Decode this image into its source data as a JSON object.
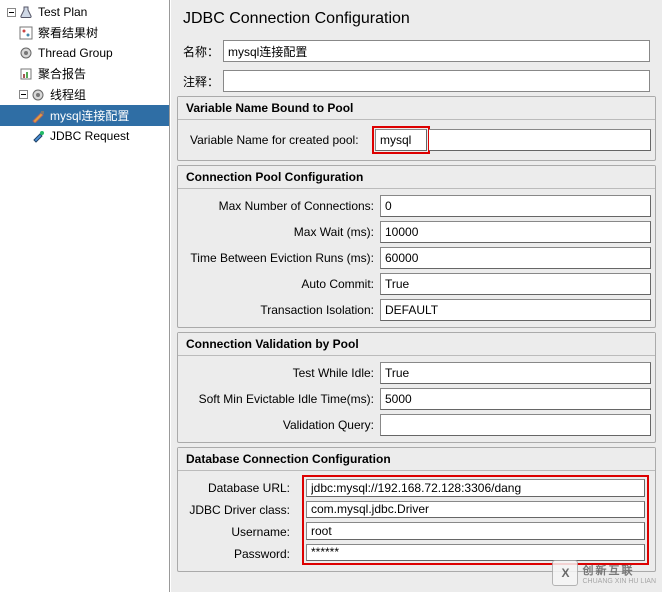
{
  "tree": {
    "root": "Test Plan",
    "items": [
      {
        "label": "察看结果树"
      },
      {
        "label": "Thread Group"
      },
      {
        "label": "聚合报告"
      },
      {
        "label": "线程组"
      },
      {
        "label": "mysql连接配置"
      },
      {
        "label": "JDBC Request"
      }
    ]
  },
  "panel": {
    "title": "JDBC Connection Configuration",
    "name_label": "名称：",
    "name_value": "mysql连接配置",
    "comment_label": "注释：",
    "comment_value": ""
  },
  "var_pool": {
    "section": "Variable Name Bound to Pool",
    "label": "Variable Name for created pool:",
    "value": "mysql"
  },
  "pool_cfg": {
    "section": "Connection Pool Configuration",
    "max_conn_label": "Max Number of Connections:",
    "max_conn_value": "0",
    "max_wait_label": "Max Wait (ms):",
    "max_wait_value": "10000",
    "evict_label": "Time Between Eviction Runs (ms):",
    "evict_value": "60000",
    "auto_commit_label": "Auto Commit:",
    "auto_commit_value": "True",
    "txn_iso_label": "Transaction Isolation:",
    "txn_iso_value": "DEFAULT"
  },
  "valid_cfg": {
    "section": "Connection Validation by Pool",
    "test_idle_label": "Test While Idle:",
    "test_idle_value": "True",
    "soft_min_label": "Soft Min Evictable Idle Time(ms):",
    "soft_min_value": "5000",
    "valid_query_label": "Validation Query:",
    "valid_query_value": ""
  },
  "db_cfg": {
    "section": "Database Connection Configuration",
    "url_label": "Database URL:",
    "url_value": "jdbc:mysql://192.168.72.128:3306/dang",
    "driver_label": "JDBC Driver class:",
    "driver_value": "com.mysql.jdbc.Driver",
    "user_label": "Username:",
    "user_value": "root",
    "pass_label": "Password:",
    "pass_value": "******"
  },
  "watermark": {
    "logo": "X",
    "brand": "创新互联",
    "sub": "CHUANG XIN HU LIAN"
  }
}
